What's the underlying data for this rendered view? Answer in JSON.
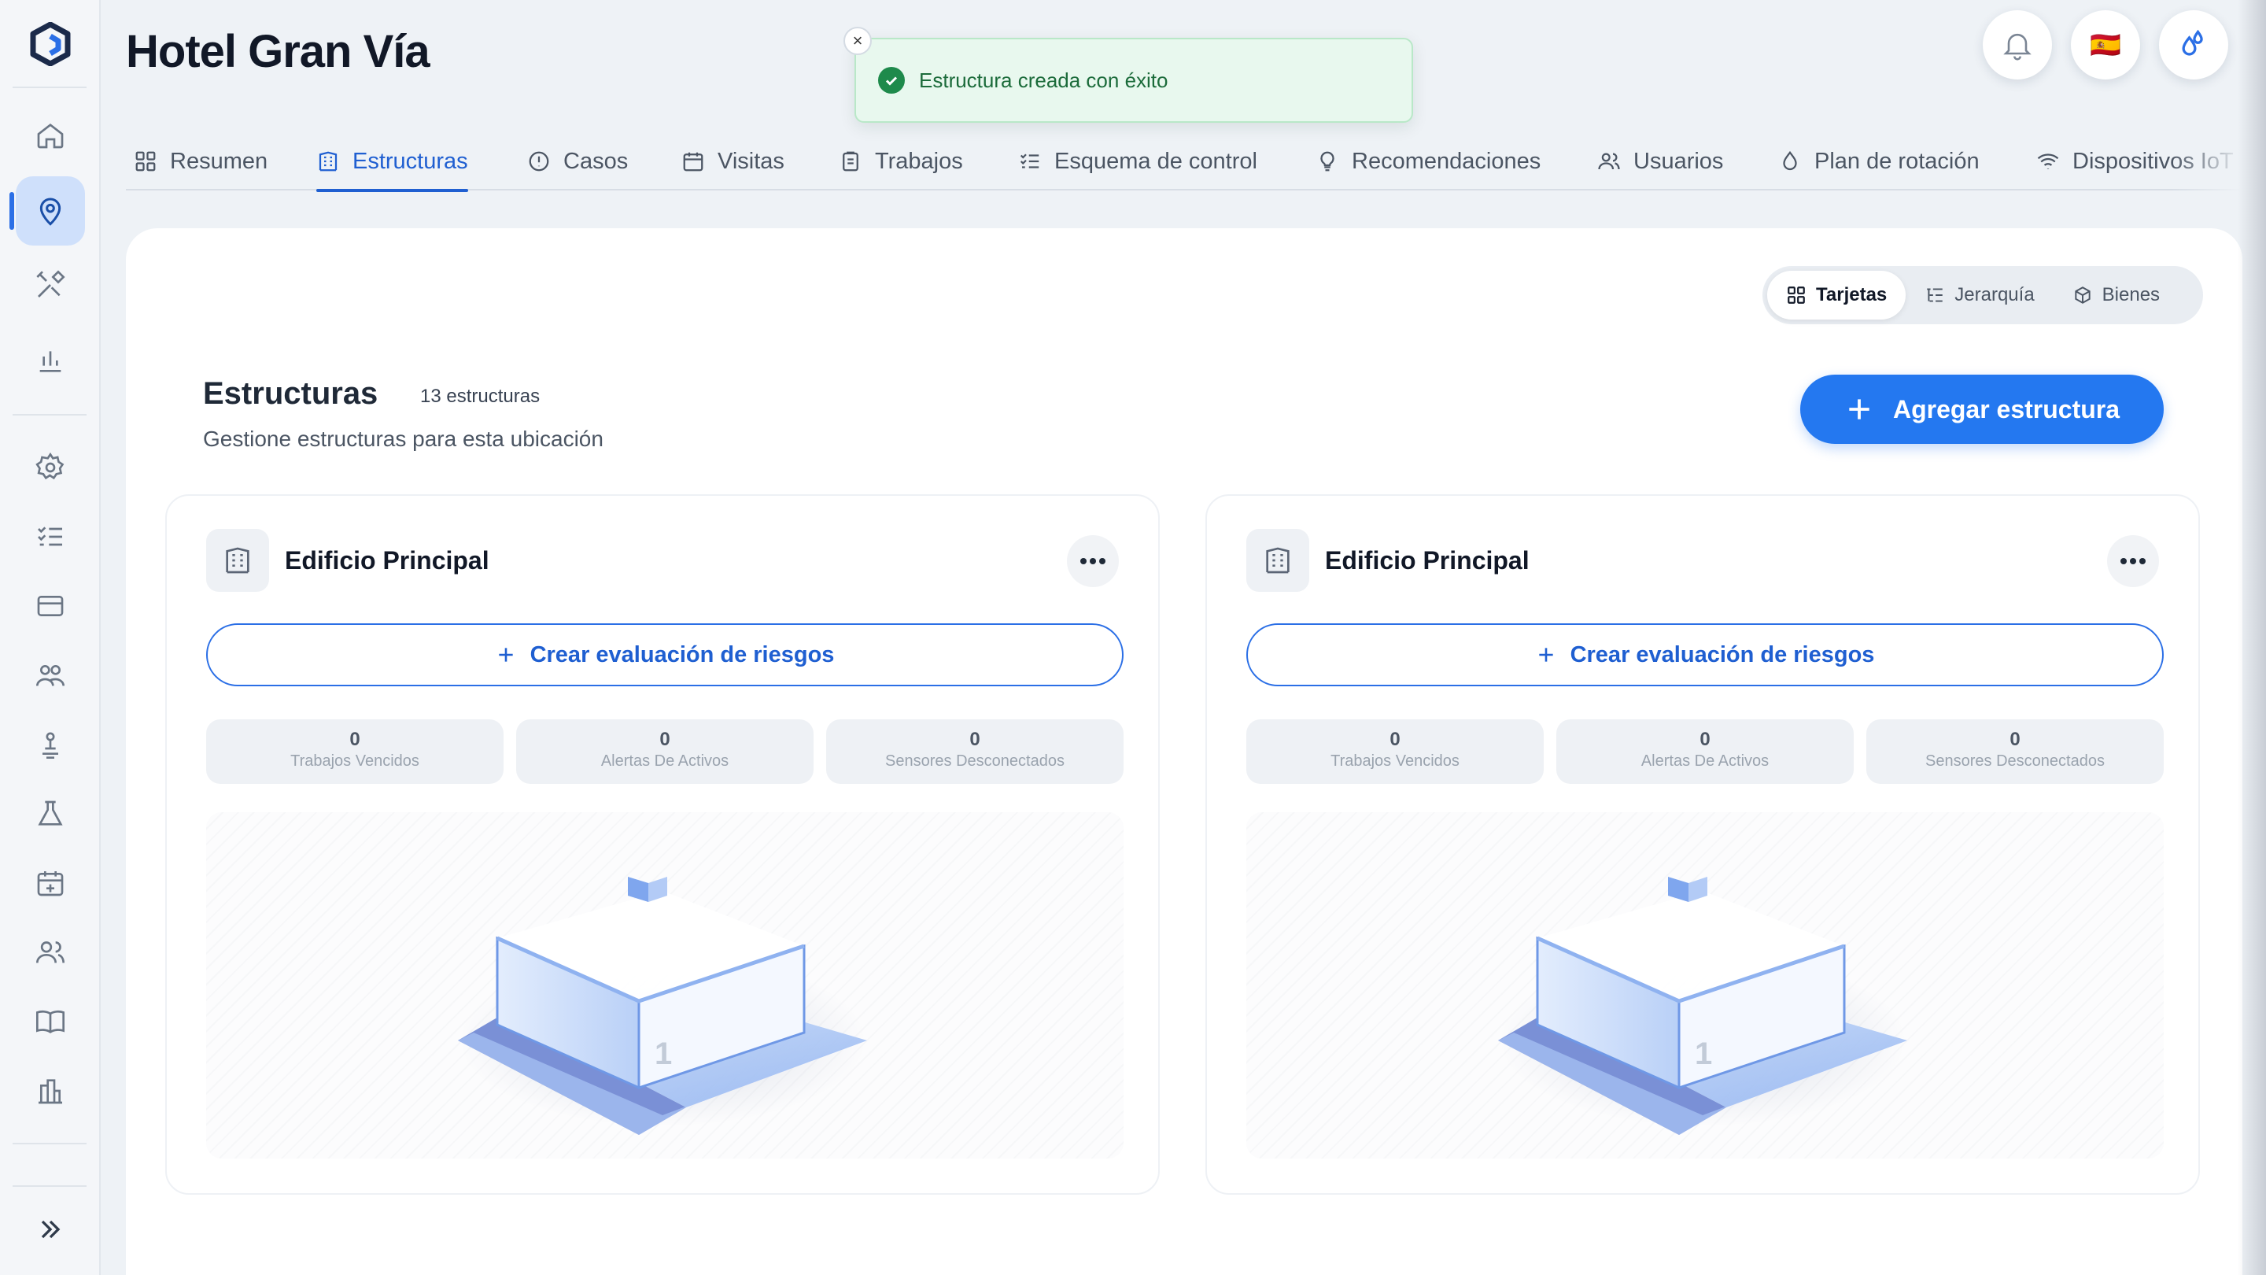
{
  "header": {
    "title": "Hotel Gran Vía",
    "language_flag": "🇪🇸"
  },
  "toast": {
    "message": "Estructura creada con éxito",
    "close": "×"
  },
  "tabs": [
    {
      "label": "Resumen",
      "icon": "grid-icon"
    },
    {
      "label": "Estructuras",
      "icon": "building-icon",
      "active": true
    },
    {
      "label": "Casos",
      "icon": "alert-circle-icon"
    },
    {
      "label": "Visitas",
      "icon": "calendar-icon"
    },
    {
      "label": "Trabajos",
      "icon": "clipboard-icon"
    },
    {
      "label": "Esquema de control",
      "icon": "checklist-icon"
    },
    {
      "label": "Recomendaciones",
      "icon": "lightbulb-icon"
    },
    {
      "label": "Usuarios",
      "icon": "users-icon"
    },
    {
      "label": "Plan de rotación",
      "icon": "droplet-icon"
    },
    {
      "label": "Dispositivos IoT",
      "icon": "wifi-icon"
    }
  ],
  "view_toggle": {
    "cards": "Tarjetas",
    "hierarchy": "Jerarquía",
    "assets": "Bienes"
  },
  "section": {
    "title": "Estructuras",
    "count": "13 estructuras",
    "subtitle": "Gestione estructuras para esta ubicación",
    "add_label": "Agregar estructura"
  },
  "cards": [
    {
      "title": "Edificio Principal",
      "risk_label": "Crear evaluación de riesgos",
      "stats": [
        {
          "value": "0",
          "label": "Trabajos Vencidos"
        },
        {
          "value": "0",
          "label": "Alertas De Activos"
        },
        {
          "value": "0",
          "label": "Sensores Desconectados"
        }
      ],
      "illustration_floor": "1"
    },
    {
      "title": "Edificio Principal",
      "risk_label": "Crear evaluación de riesgos",
      "stats": [
        {
          "value": "0",
          "label": "Trabajos Vencidos"
        },
        {
          "value": "0",
          "label": "Alertas De Activos"
        },
        {
          "value": "0",
          "label": "Sensores Desconectados"
        }
      ],
      "illustration_floor": "1"
    }
  ],
  "colors": {
    "accent": "#2478f0",
    "success": "#1e8a4b",
    "sidebar_active": "#cfe0fb"
  }
}
